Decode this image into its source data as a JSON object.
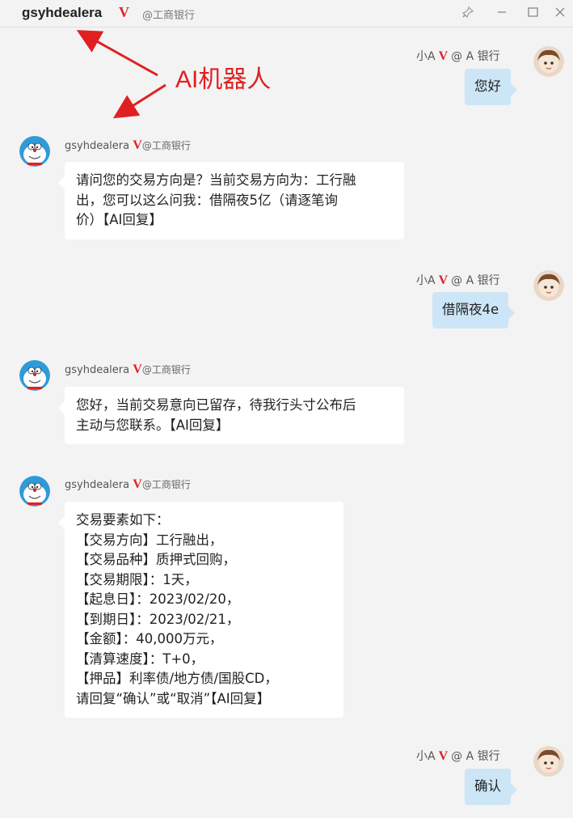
{
  "window": {
    "title": "gsyhdealera",
    "verified_mark": "V",
    "org": "@工商银行",
    "pin_icon": "pin-icon",
    "minimize_icon": "minimize-icon",
    "maximize_icon": "maximize-icon",
    "close_icon": "close-icon"
  },
  "annotation": {
    "text": "AI机器人",
    "color": "#e02020"
  },
  "me": {
    "name": "小A",
    "verified_mark": "V",
    "org": "@ A 银行",
    "bubble_color": "#cde6f7"
  },
  "bot": {
    "name": "gsyhdealera",
    "verified_mark": "V",
    "org": "@工商银行"
  },
  "messages": [
    {
      "from": "me",
      "text": "您好"
    },
    {
      "from": "bot",
      "lines": [
        "请问您的交易方向是？当前交易方向为：工行融",
        "出，您可以这么问我：借隔夜5亿（请逐笔询",
        "价）【AI回复】"
      ]
    },
    {
      "from": "me",
      "text": "借隔夜4e"
    },
    {
      "from": "bot",
      "lines": [
        "您好，当前交易意向已留存，待我行头寸公布后",
        "主动与您联系。【AI回复】"
      ]
    },
    {
      "from": "bot",
      "lines": [
        "交易要素如下：",
        "【交易方向】工行融出，",
        "【交易品种】质押式回购，",
        "【交易期限】：1天，",
        "【起息日】：2023/02/20，",
        "【到期日】：2023/02/21，",
        "【金额】：40,000万元，",
        "【清算速度】：T+0，",
        "【押品】利率债/地方债/国股CD，",
        "请回复“确认”或“取消”【AI回复】"
      ]
    },
    {
      "from": "me",
      "text": "确认"
    }
  ]
}
